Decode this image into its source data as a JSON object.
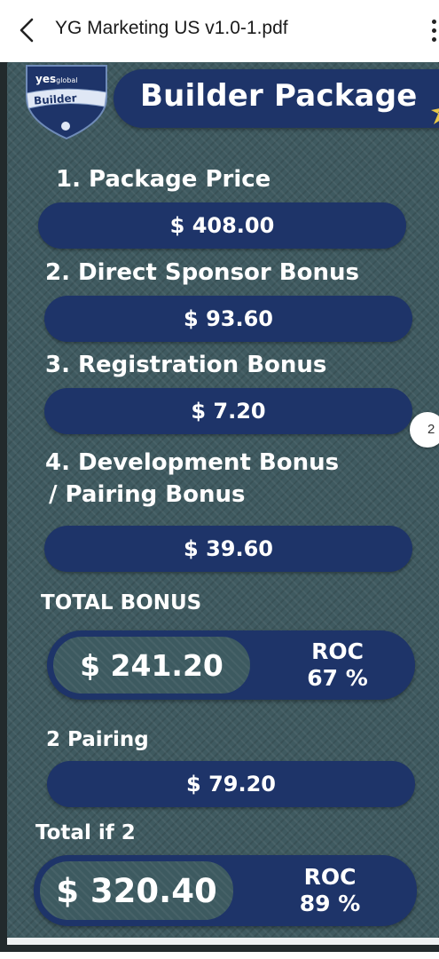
{
  "appbar": {
    "back_icon": "chevron-left-icon",
    "title": "YG Marketing US v1.0-1.pdf",
    "more_icon": "more-vertical-icon"
  },
  "badge": {
    "brand": "yes",
    "brand_suffix": "global",
    "label": "Builder"
  },
  "banner": {
    "title": "Builder Package"
  },
  "sections": [
    {
      "heading": "1. Package Price",
      "value": "$ 408.00"
    },
    {
      "heading": "2. Direct Sponsor Bonus",
      "value": "$ 93.60"
    },
    {
      "heading": "3. Registration Bonus",
      "value": "$ 7.20"
    },
    {
      "heading_line1": "4. Development Bonus",
      "heading_line2": "/ Pairing Bonus",
      "value": "$ 39.60"
    }
  ],
  "total_bonus": {
    "heading": "TOTAL BONUS",
    "value": "$ 241.20",
    "roc_label": "ROC",
    "roc_value": "67 %"
  },
  "pairing": {
    "heading": "2 Pairing",
    "value": "$ 79.20"
  },
  "total_if_2": {
    "heading": "Total if 2",
    "value": "$ 320.40",
    "roc_label": "ROC",
    "roc_value": "89 %"
  },
  "page_indicator": "2",
  "colors": {
    "navy": "#1e3469",
    "board": "#3f5a60",
    "text": "#ffffff"
  }
}
